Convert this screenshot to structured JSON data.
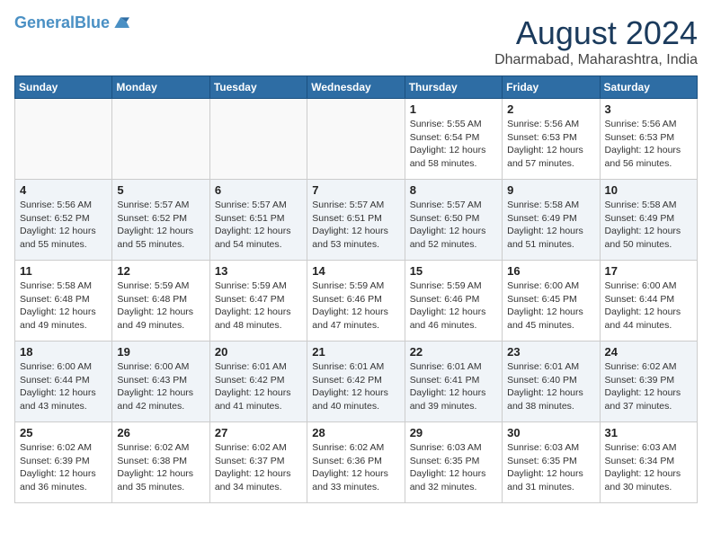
{
  "header": {
    "logo_line1": "General",
    "logo_line2": "Blue",
    "title": "August 2024",
    "subtitle": "Dharmabad, Maharashtra, India"
  },
  "weekdays": [
    "Sunday",
    "Monday",
    "Tuesday",
    "Wednesday",
    "Thursday",
    "Friday",
    "Saturday"
  ],
  "weeks": [
    [
      {
        "day": "",
        "info": ""
      },
      {
        "day": "",
        "info": ""
      },
      {
        "day": "",
        "info": ""
      },
      {
        "day": "",
        "info": ""
      },
      {
        "day": "1",
        "info": "Sunrise: 5:55 AM\nSunset: 6:54 PM\nDaylight: 12 hours\nand 58 minutes."
      },
      {
        "day": "2",
        "info": "Sunrise: 5:56 AM\nSunset: 6:53 PM\nDaylight: 12 hours\nand 57 minutes."
      },
      {
        "day": "3",
        "info": "Sunrise: 5:56 AM\nSunset: 6:53 PM\nDaylight: 12 hours\nand 56 minutes."
      }
    ],
    [
      {
        "day": "4",
        "info": "Sunrise: 5:56 AM\nSunset: 6:52 PM\nDaylight: 12 hours\nand 55 minutes."
      },
      {
        "day": "5",
        "info": "Sunrise: 5:57 AM\nSunset: 6:52 PM\nDaylight: 12 hours\nand 55 minutes."
      },
      {
        "day": "6",
        "info": "Sunrise: 5:57 AM\nSunset: 6:51 PM\nDaylight: 12 hours\nand 54 minutes."
      },
      {
        "day": "7",
        "info": "Sunrise: 5:57 AM\nSunset: 6:51 PM\nDaylight: 12 hours\nand 53 minutes."
      },
      {
        "day": "8",
        "info": "Sunrise: 5:57 AM\nSunset: 6:50 PM\nDaylight: 12 hours\nand 52 minutes."
      },
      {
        "day": "9",
        "info": "Sunrise: 5:58 AM\nSunset: 6:49 PM\nDaylight: 12 hours\nand 51 minutes."
      },
      {
        "day": "10",
        "info": "Sunrise: 5:58 AM\nSunset: 6:49 PM\nDaylight: 12 hours\nand 50 minutes."
      }
    ],
    [
      {
        "day": "11",
        "info": "Sunrise: 5:58 AM\nSunset: 6:48 PM\nDaylight: 12 hours\nand 49 minutes."
      },
      {
        "day": "12",
        "info": "Sunrise: 5:59 AM\nSunset: 6:48 PM\nDaylight: 12 hours\nand 49 minutes."
      },
      {
        "day": "13",
        "info": "Sunrise: 5:59 AM\nSunset: 6:47 PM\nDaylight: 12 hours\nand 48 minutes."
      },
      {
        "day": "14",
        "info": "Sunrise: 5:59 AM\nSunset: 6:46 PM\nDaylight: 12 hours\nand 47 minutes."
      },
      {
        "day": "15",
        "info": "Sunrise: 5:59 AM\nSunset: 6:46 PM\nDaylight: 12 hours\nand 46 minutes."
      },
      {
        "day": "16",
        "info": "Sunrise: 6:00 AM\nSunset: 6:45 PM\nDaylight: 12 hours\nand 45 minutes."
      },
      {
        "day": "17",
        "info": "Sunrise: 6:00 AM\nSunset: 6:44 PM\nDaylight: 12 hours\nand 44 minutes."
      }
    ],
    [
      {
        "day": "18",
        "info": "Sunrise: 6:00 AM\nSunset: 6:44 PM\nDaylight: 12 hours\nand 43 minutes."
      },
      {
        "day": "19",
        "info": "Sunrise: 6:00 AM\nSunset: 6:43 PM\nDaylight: 12 hours\nand 42 minutes."
      },
      {
        "day": "20",
        "info": "Sunrise: 6:01 AM\nSunset: 6:42 PM\nDaylight: 12 hours\nand 41 minutes."
      },
      {
        "day": "21",
        "info": "Sunrise: 6:01 AM\nSunset: 6:42 PM\nDaylight: 12 hours\nand 40 minutes."
      },
      {
        "day": "22",
        "info": "Sunrise: 6:01 AM\nSunset: 6:41 PM\nDaylight: 12 hours\nand 39 minutes."
      },
      {
        "day": "23",
        "info": "Sunrise: 6:01 AM\nSunset: 6:40 PM\nDaylight: 12 hours\nand 38 minutes."
      },
      {
        "day": "24",
        "info": "Sunrise: 6:02 AM\nSunset: 6:39 PM\nDaylight: 12 hours\nand 37 minutes."
      }
    ],
    [
      {
        "day": "25",
        "info": "Sunrise: 6:02 AM\nSunset: 6:39 PM\nDaylight: 12 hours\nand 36 minutes."
      },
      {
        "day": "26",
        "info": "Sunrise: 6:02 AM\nSunset: 6:38 PM\nDaylight: 12 hours\nand 35 minutes."
      },
      {
        "day": "27",
        "info": "Sunrise: 6:02 AM\nSunset: 6:37 PM\nDaylight: 12 hours\nand 34 minutes."
      },
      {
        "day": "28",
        "info": "Sunrise: 6:02 AM\nSunset: 6:36 PM\nDaylight: 12 hours\nand 33 minutes."
      },
      {
        "day": "29",
        "info": "Sunrise: 6:03 AM\nSunset: 6:35 PM\nDaylight: 12 hours\nand 32 minutes."
      },
      {
        "day": "30",
        "info": "Sunrise: 6:03 AM\nSunset: 6:35 PM\nDaylight: 12 hours\nand 31 minutes."
      },
      {
        "day": "31",
        "info": "Sunrise: 6:03 AM\nSunset: 6:34 PM\nDaylight: 12 hours\nand 30 minutes."
      }
    ]
  ]
}
